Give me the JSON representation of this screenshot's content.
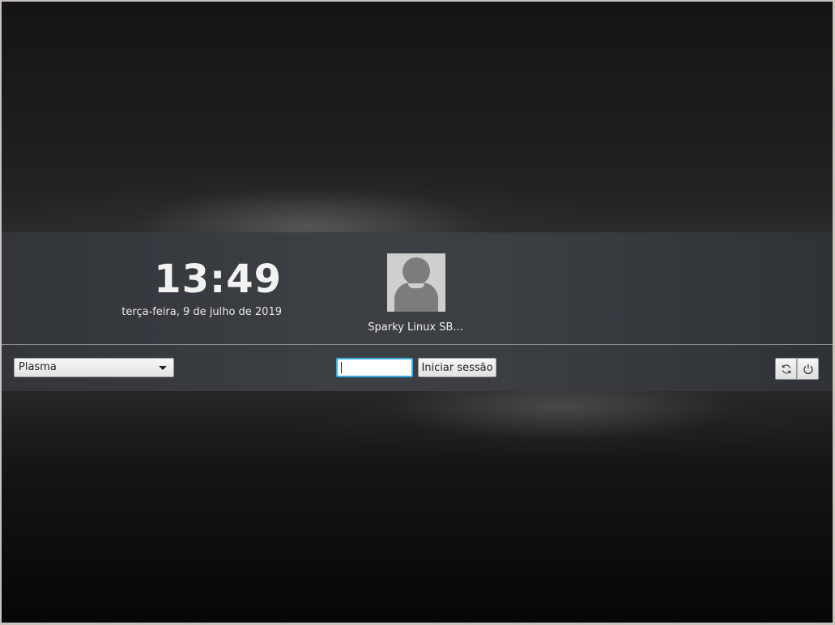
{
  "greeter": {
    "clock": "13:49",
    "date": "terça-feira, 9 de julho de 2019",
    "user": {
      "name": "Sparky Linux SB...",
      "avatar_icon": "user-avatar-icon"
    },
    "session": {
      "selected": "Plasma",
      "dropdown_icon": "chevron-down-icon"
    },
    "password": {
      "value": "",
      "placeholder": ""
    },
    "login_button": "Iniciar sessão",
    "power_buttons": [
      {
        "name": "reboot",
        "icon": "reboot-icon"
      },
      {
        "name": "shutdown",
        "icon": "power-icon"
      }
    ]
  },
  "colors": {
    "accent": "#3daee9",
    "panel": "#3b3f44",
    "background": "#1a1a1a"
  }
}
